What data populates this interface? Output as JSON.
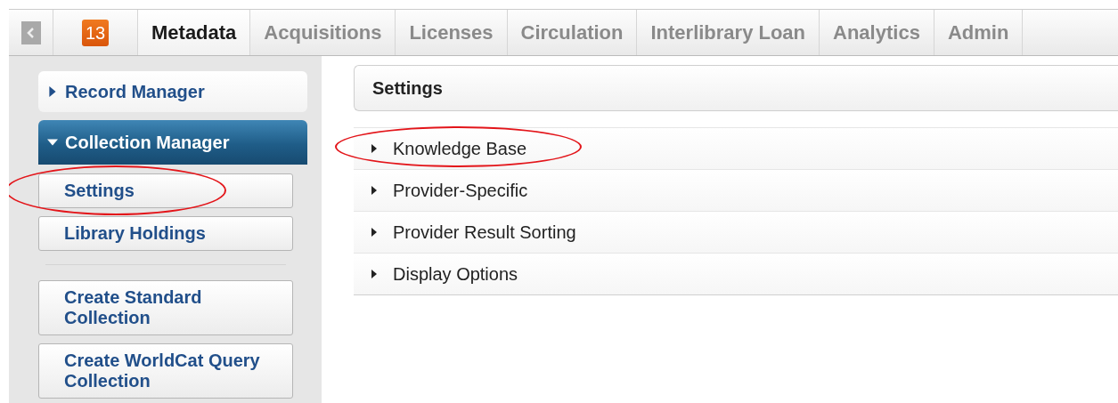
{
  "tab_bar": {
    "badge": "13",
    "tabs": [
      {
        "label": "Metadata",
        "selected": true
      },
      {
        "label": "Acquisitions",
        "selected": false
      },
      {
        "label": "Licenses",
        "selected": false
      },
      {
        "label": "Circulation",
        "selected": false
      },
      {
        "label": "Interlibrary Loan",
        "selected": false
      },
      {
        "label": "Analytics",
        "selected": false
      },
      {
        "label": "Admin",
        "selected": false
      }
    ]
  },
  "sidebar": {
    "sections": [
      {
        "label": "Record Manager",
        "expanded": false
      },
      {
        "label": "Collection Manager",
        "expanded": true,
        "button_groups": [
          [
            {
              "label": "Settings",
              "circled": true
            },
            {
              "label": "Library Holdings",
              "circled": false
            }
          ],
          [
            {
              "label": "Create Standard Collection",
              "circled": false
            },
            {
              "label": "Create WorldCat Query Collection",
              "circled": false
            }
          ]
        ]
      }
    ]
  },
  "main": {
    "title": "Settings",
    "rows": [
      {
        "label": "Knowledge Base",
        "expanded": false,
        "circled": true
      },
      {
        "label": "Provider-Specific",
        "expanded": false,
        "circled": false
      },
      {
        "label": "Provider Result Sorting",
        "expanded": false,
        "circled": false
      },
      {
        "label": "Display Options",
        "expanded": false,
        "circled": false
      }
    ]
  }
}
